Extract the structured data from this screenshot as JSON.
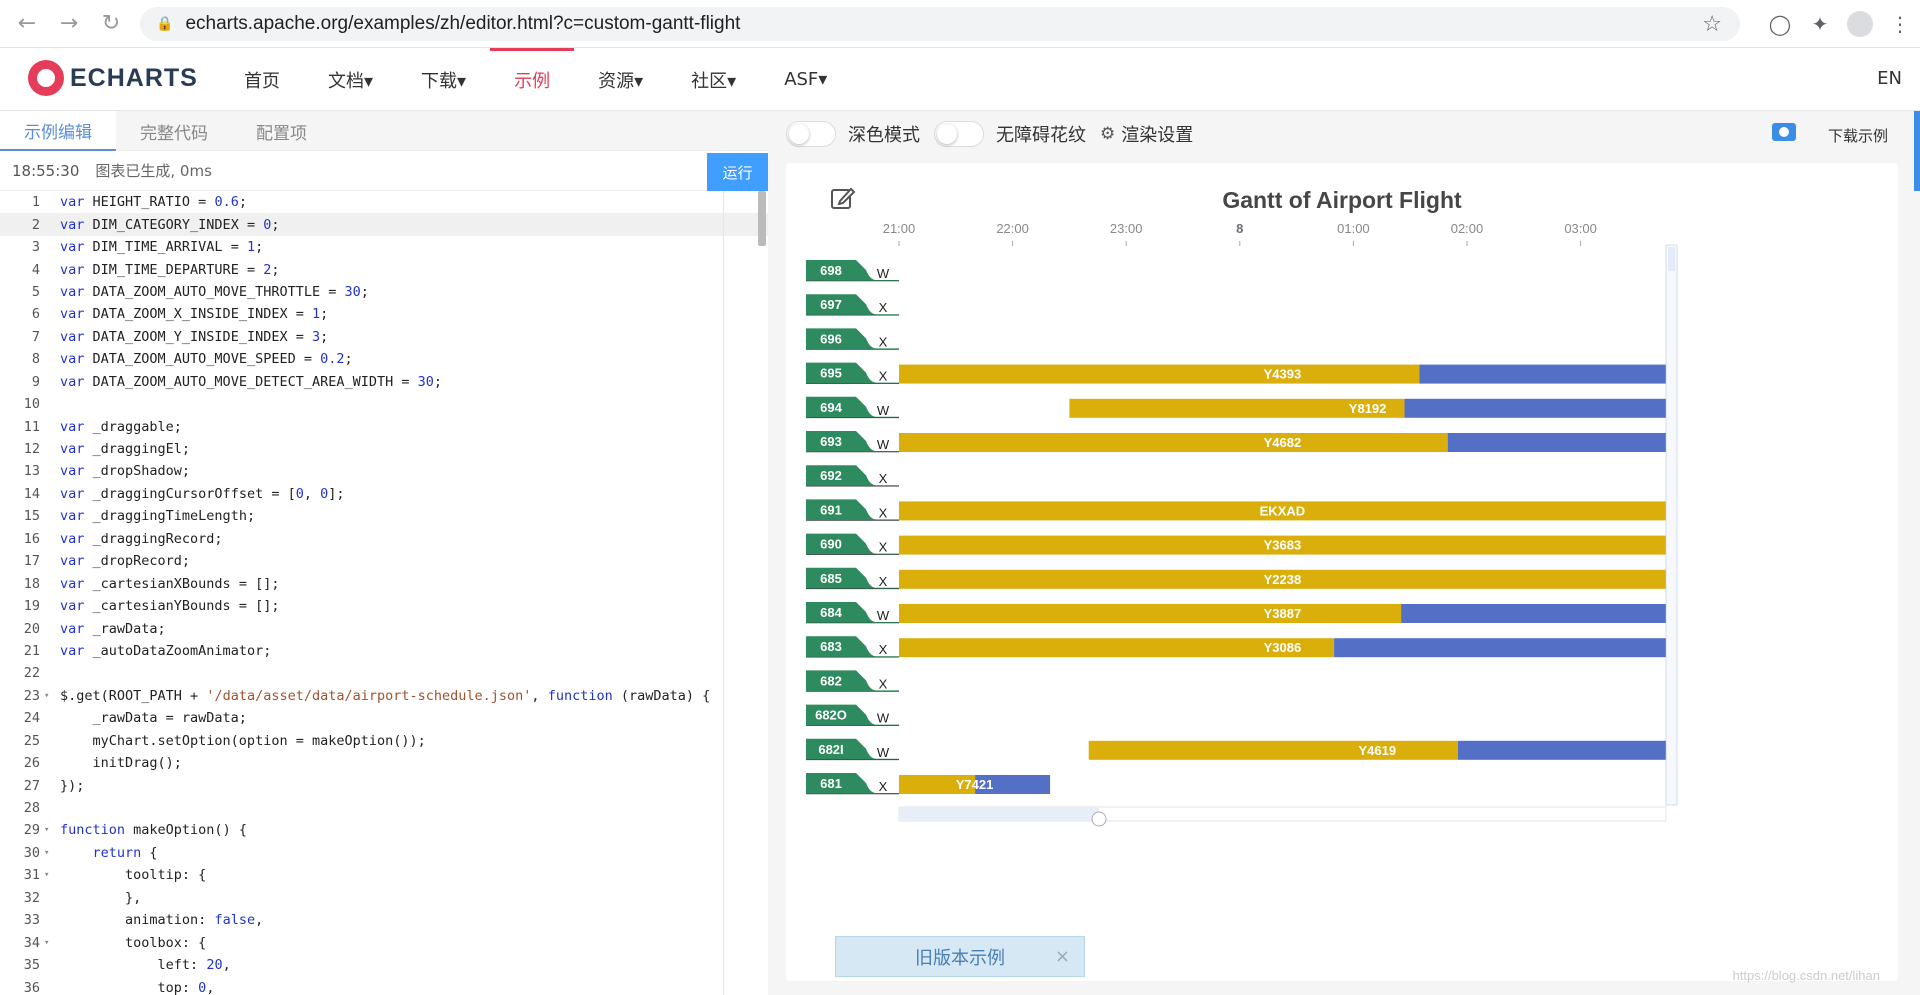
{
  "browser": {
    "url": "echarts.apache.org/examples/zh/editor.html?c=custom-gantt-flight"
  },
  "site": {
    "logo": "ECHARTS",
    "nav": [
      "首页",
      "文档▾",
      "下载▾",
      "示例",
      "资源▾",
      "社区▾",
      "ASF▾"
    ],
    "lang": "EN"
  },
  "editor": {
    "tabs": [
      "示例编辑",
      "完整代码",
      "配置项"
    ],
    "time": "18:55:30",
    "status": "图表已生成, 0ms",
    "run": "运行",
    "lines": [
      {
        "n": "1",
        "t": "var HEIGHT_RATIO = 0.6;"
      },
      {
        "n": "2",
        "t": "var DIM_CATEGORY_INDEX = 0;"
      },
      {
        "n": "3",
        "t": "var DIM_TIME_ARRIVAL = 1;"
      },
      {
        "n": "4",
        "t": "var DIM_TIME_DEPARTURE = 2;"
      },
      {
        "n": "5",
        "t": "var DATA_ZOOM_AUTO_MOVE_THROTTLE = 30;"
      },
      {
        "n": "6",
        "t": "var DATA_ZOOM_X_INSIDE_INDEX = 1;"
      },
      {
        "n": "7",
        "t": "var DATA_ZOOM_Y_INSIDE_INDEX = 3;"
      },
      {
        "n": "8",
        "t": "var DATA_ZOOM_AUTO_MOVE_SPEED = 0.2;"
      },
      {
        "n": "9",
        "t": "var DATA_ZOOM_AUTO_MOVE_DETECT_AREA_WIDTH = 30;"
      },
      {
        "n": "10",
        "t": ""
      },
      {
        "n": "11",
        "t": "var _draggable;"
      },
      {
        "n": "12",
        "t": "var _draggingEl;"
      },
      {
        "n": "13",
        "t": "var _dropShadow;"
      },
      {
        "n": "14",
        "t": "var _draggingCursorOffset = [0, 0];"
      },
      {
        "n": "15",
        "t": "var _draggingTimeLength;"
      },
      {
        "n": "16",
        "t": "var _draggingRecord;"
      },
      {
        "n": "17",
        "t": "var _dropRecord;"
      },
      {
        "n": "18",
        "t": "var _cartesianXBounds = [];"
      },
      {
        "n": "19",
        "t": "var _cartesianYBounds = [];"
      },
      {
        "n": "20",
        "t": "var _rawData;"
      },
      {
        "n": "21",
        "t": "var _autoDataZoomAnimator;"
      },
      {
        "n": "22",
        "t": ""
      },
      {
        "n": "23",
        "t": "$.get(ROOT_PATH + '/data/asset/data/airport-schedule.json', function (rawData) {",
        "fold": true
      },
      {
        "n": "24",
        "t": "    _rawData = rawData;"
      },
      {
        "n": "25",
        "t": "    myChart.setOption(option = makeOption());"
      },
      {
        "n": "26",
        "t": "    initDrag();"
      },
      {
        "n": "27",
        "t": "});"
      },
      {
        "n": "28",
        "t": ""
      },
      {
        "n": "29",
        "t": "function makeOption() {",
        "fold": true
      },
      {
        "n": "30",
        "t": "    return {",
        "fold": true
      },
      {
        "n": "31",
        "t": "        tooltip: {",
        "fold": true
      },
      {
        "n": "32",
        "t": "        },"
      },
      {
        "n": "33",
        "t": "        animation: false,"
      },
      {
        "n": "34",
        "t": "        toolbox: {",
        "fold": true
      },
      {
        "n": "35",
        "t": "            left: 20,"
      },
      {
        "n": "36",
        "t": "            top: 0,"
      }
    ]
  },
  "preview": {
    "dark_mode": "深色模式",
    "aria": "无障碍花纹",
    "render": "渲染设置",
    "download": "下载示例",
    "old_version": "旧版本示例",
    "watermark": "https://blog.csdn.net/lihan"
  },
  "chart_data": {
    "type": "gantt",
    "title": "Gantt of Airport Flight",
    "x_ticks": [
      "21:00",
      "22:00",
      "23:00",
      "8",
      "01:00",
      "02:00",
      "03:00"
    ],
    "x_range_hours": [
      20.0,
      27.25
    ],
    "rows": [
      {
        "id": "698",
        "type": "W",
        "bars": []
      },
      {
        "id": "697",
        "type": "X",
        "bars": []
      },
      {
        "id": "696",
        "type": "X",
        "bars": []
      },
      {
        "id": "695",
        "type": "X",
        "bars": [
          {
            "label": "Y4393",
            "start": 21.0,
            "mid": 25.58,
            "end": 27.75
          }
        ]
      },
      {
        "id": "694",
        "type": "W",
        "bars": [
          {
            "label": "Y8192",
            "start": 22.5,
            "mid": 25.45,
            "end": 27.75
          }
        ]
      },
      {
        "id": "693",
        "type": "W",
        "bars": [
          {
            "label": "Y4682",
            "start": 21.0,
            "mid": 25.83,
            "end": 27.75
          }
        ]
      },
      {
        "id": "692",
        "type": "X",
        "bars": []
      },
      {
        "id": "691",
        "type": "X",
        "bars": [
          {
            "label": "EKXAD",
            "start": 21.0,
            "mid": 27.75,
            "end": 27.75
          }
        ]
      },
      {
        "id": "690",
        "type": "X",
        "bars": [
          {
            "label": "Y3683",
            "start": 21.0,
            "mid": 27.75,
            "end": 27.75
          }
        ]
      },
      {
        "id": "685",
        "type": "X",
        "bars": [
          {
            "label": "Y2238",
            "start": 21.0,
            "mid": 27.75,
            "end": 27.75
          }
        ]
      },
      {
        "id": "684",
        "type": "W",
        "bars": [
          {
            "label": "Y3887",
            "start": 21.0,
            "mid": 25.42,
            "end": 27.75
          }
        ]
      },
      {
        "id": "683",
        "type": "X",
        "bars": [
          {
            "label": "Y3086",
            "start": 21.0,
            "mid": 24.83,
            "end": 27.75
          }
        ]
      },
      {
        "id": "682",
        "type": "X",
        "bars": []
      },
      {
        "id": "682O",
        "type": "W",
        "bars": []
      },
      {
        "id": "682I",
        "type": "W",
        "bars": [
          {
            "label": "Y4619",
            "start": 22.67,
            "mid": 25.92,
            "end": 27.75
          }
        ]
      },
      {
        "id": "681",
        "type": "X",
        "bars": [
          {
            "label": "Y7421",
            "start": 21.0,
            "mid": 21.67,
            "end": 22.33
          }
        ]
      }
    ],
    "colors": {
      "arrival": "#dbaf0b",
      "departure": "#5470c6",
      "row_tag": "#2e8a5f",
      "grid": "#eaeaea"
    }
  }
}
